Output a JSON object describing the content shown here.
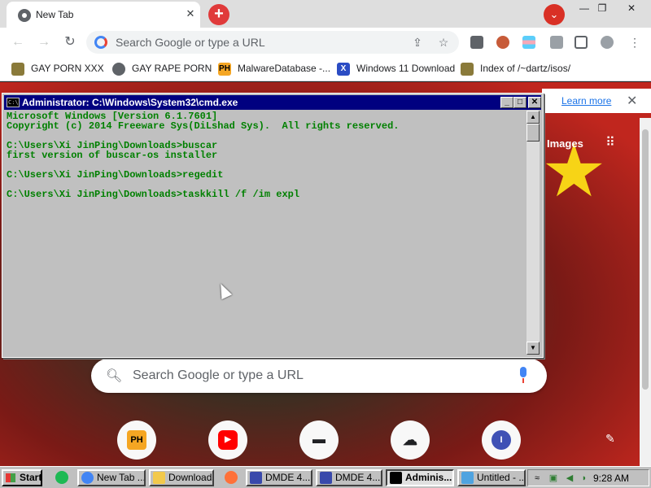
{
  "browser": {
    "tab": {
      "title": "New Tab",
      "close": "✕"
    },
    "new_tab_button": "+",
    "profile_menu_icon": "chevron-down-icon",
    "window_controls": {
      "minimize": "—",
      "maximize": "❐",
      "close": "✕"
    },
    "omnibox": {
      "placeholder": "Search Google or type a URL"
    },
    "bookmarks": [
      {
        "label": "GAY PORN XXX",
        "icon": "person-icon",
        "color": "#5f6368"
      },
      {
        "label": "GAY RAPE PORN",
        "icon": "globe-icon",
        "color": "#5f6368"
      },
      {
        "label": "MalwareDatabase -...",
        "icon": "ph-icon",
        "color": "#f5a623",
        "badge": "PH"
      },
      {
        "label": "Windows 11 Download",
        "icon": "x-icon",
        "color": "#2b4cc4",
        "badge": "X"
      },
      {
        "label": "Index of /~dartz/isos/",
        "icon": "person-icon",
        "color": "#8a7a3a"
      }
    ]
  },
  "ntp": {
    "learn_more": "Learn more",
    "images": "Images",
    "search_placeholder": "Search Google or type a URL",
    "shortcuts": [
      {
        "label": "PH",
        "color": "#f5a623"
      },
      {
        "label": "▶",
        "color": "#ff0000"
      },
      {
        "label": "▬",
        "color": "#202124"
      },
      {
        "label": "☁",
        "color": "#202124"
      },
      {
        "label": "I",
        "color": "#3f51b5"
      }
    ]
  },
  "cmd": {
    "title": "Administrator: C:\\Windows\\System32\\cmd.exe",
    "lines": [
      "Microsoft Windows [Version 6.1.7601]",
      "Copyright (c) 2014 Freeware Sys(DiLshad Sys).  All rights reserved.",
      "",
      "C:\\Users\\Xi JinPing\\Downloads>buscar",
      "first version of buscar-os installer",
      "",
      "C:\\Users\\Xi JinPing\\Downloads>regedit",
      "",
      "C:\\Users\\Xi JinPing\\Downloads>taskkill /f /im expl"
    ]
  },
  "taskbar": {
    "start": "Start",
    "tasks": [
      {
        "label": "New Tab ...",
        "color": "#4285f4",
        "active": false
      },
      {
        "label": "Downloads",
        "color": "#f2c94c",
        "active": false
      },
      {
        "label": "DMDE 4....",
        "color": "#3949ab",
        "active": false
      },
      {
        "label": "DMDE 4....",
        "color": "#3949ab",
        "active": false
      },
      {
        "label": "Adminis...",
        "color": "#000000",
        "active": true
      },
      {
        "label": "Untitled - ...",
        "color": "#4fa3e0",
        "active": false
      }
    ],
    "clock": "9:28 AM"
  }
}
